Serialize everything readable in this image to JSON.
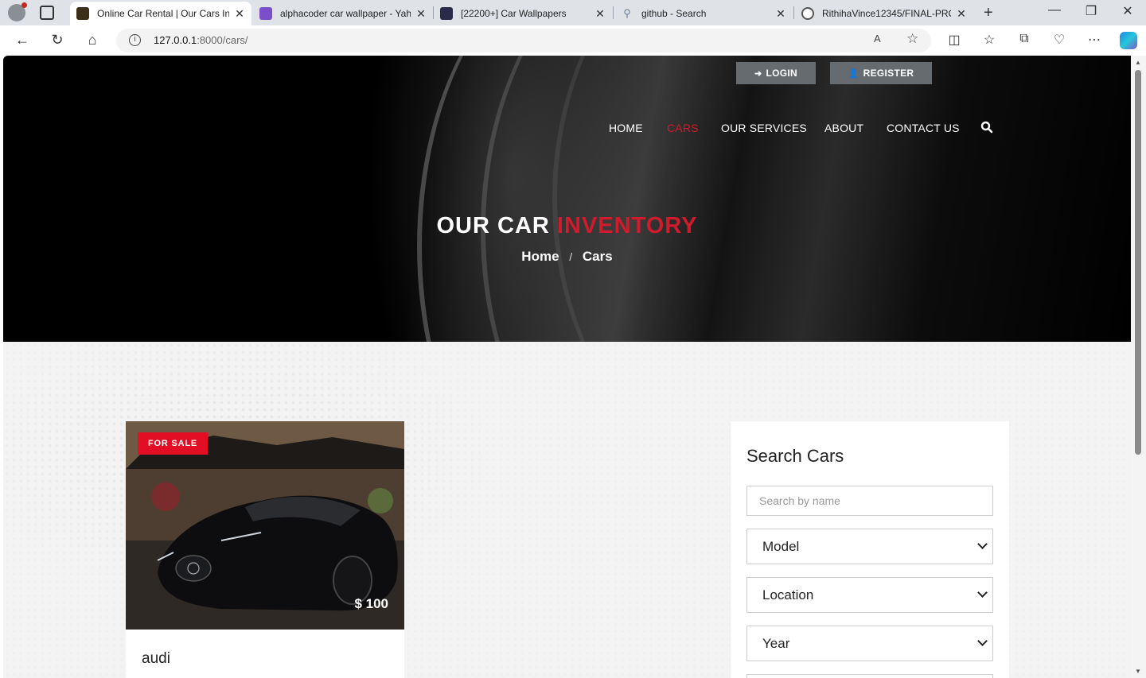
{
  "browser": {
    "tabs": [
      {
        "title": "Online Car Rental | Our Cars In",
        "favicon_color": "#3b2f1a",
        "active": true
      },
      {
        "title": "alphacoder car wallpaper - Yah",
        "favicon_color": "#7b4fc9",
        "active": false
      },
      {
        "title": "[22200+] Car Wallpapers",
        "favicon_color": "#2a2a4a",
        "active": false
      },
      {
        "title": "github - Search",
        "favicon_color": "#ffffff",
        "active": false
      },
      {
        "title": "RithihaVince12345/FINAL-PRO",
        "favicon_color": "#ffffff",
        "active": false
      }
    ],
    "url_host": "127.0.0.1",
    "url_path": ":8000/cars/"
  },
  "auth": {
    "login_label": "LOGIN",
    "register_label": "REGISTER"
  },
  "nav": {
    "items": [
      "HOME",
      "CARS",
      "OUR SERVICES",
      "ABOUT",
      "CONTACT US"
    ],
    "active": "CARS"
  },
  "hero": {
    "title_main": "OUR CAR",
    "title_accent": "INVENTORY",
    "breadcrumb": [
      "Home",
      "Cars"
    ]
  },
  "car": {
    "badge": "FOR SALE",
    "price": "$ 100",
    "name": "audi"
  },
  "search": {
    "heading": "Search Cars",
    "name_placeholder": "Search by name",
    "selects": [
      "Model",
      "Location",
      "Year"
    ]
  },
  "colors": {
    "accent": "#cf1b2b",
    "sale_badge": "#e30d24",
    "auth_button": "#666b70"
  }
}
